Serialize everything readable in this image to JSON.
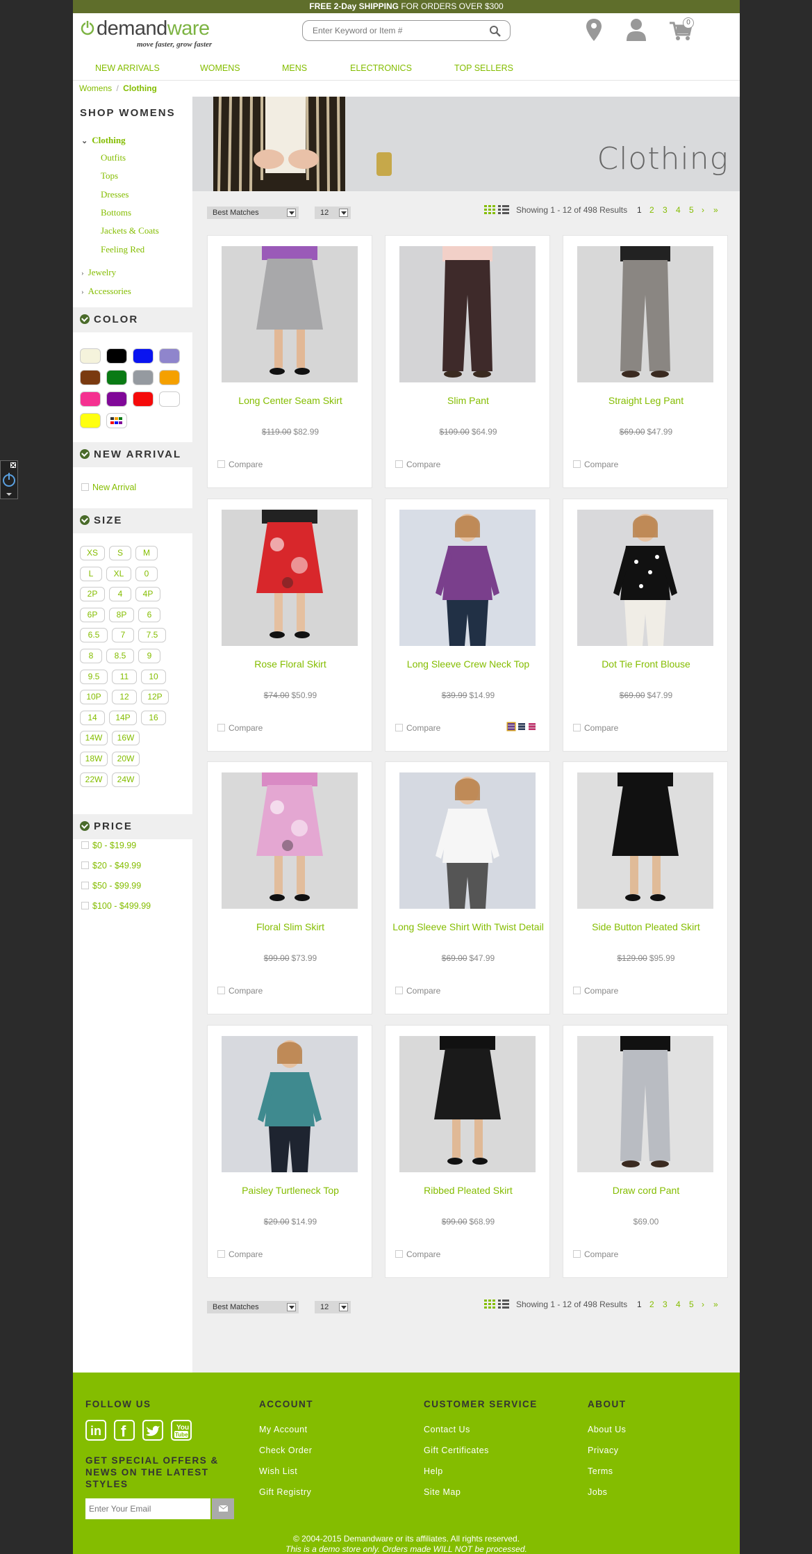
{
  "promo": {
    "bold": "FREE 2-Day SHIPPING",
    "rest": "FOR ORDERS OVER $300"
  },
  "logo": {
    "demand": "demand",
    "ware": "ware",
    "tagline": "move faster, grow faster"
  },
  "search": {
    "placeholder": "Enter Keyword or Item #"
  },
  "cart": {
    "count": "0"
  },
  "nav": [
    "NEW ARRIVALS",
    "WOMENS",
    "MENS",
    "ELECTRONICS",
    "TOP SELLERS"
  ],
  "breadcrumb": {
    "parent": "Womens",
    "separator": "/",
    "current": "Clothing"
  },
  "sidebar": {
    "shop_title": "SHOP WOMENS",
    "categories": {
      "active": "Clothing",
      "sub": [
        "Outfits",
        "Tops",
        "Dresses",
        "Bottoms",
        "Jackets & Coats",
        "Feeling Red"
      ],
      "others": [
        "Jewelry",
        "Accessories"
      ]
    },
    "color_title": "COLOR",
    "colors": [
      "#f5f3dc",
      "#000000",
      "#0a14f0",
      "#8f85cc",
      "#7a3a10",
      "#0a7a14",
      "#959aa0",
      "#f5a000",
      "#f53090",
      "#800898",
      "#f50a0a",
      "#ffffff",
      "#ffff10",
      "multicolor"
    ],
    "new_arrival_title": "NEW ARRIVAL",
    "new_arrival_option": "New Arrival",
    "size_title": "SIZE",
    "sizes": [
      "XS",
      "S",
      "M",
      "L",
      "XL",
      "0",
      "2P",
      "4",
      "4P",
      "6P",
      "8P",
      "6",
      "6.5",
      "7",
      "7.5",
      "8",
      "8.5",
      "9",
      "9.5",
      "11",
      "10",
      "10P",
      "12",
      "12P",
      "14",
      "14P",
      "16",
      "14W",
      "16W",
      "18W",
      "20W",
      "22W",
      "24W"
    ],
    "price_title": "PRICE",
    "prices": [
      "$0 - $19.99",
      "$20 - $49.99",
      "$50 - $99.99",
      "$100 - $499.99"
    ]
  },
  "banner": {
    "title": "Clothing"
  },
  "toolbar": {
    "sort": "Best Matches",
    "per_page": "12",
    "results": "Showing 1 - 12 of 498 Results",
    "pages": [
      "1",
      "2",
      "3",
      "4",
      "5"
    ],
    "next": "›",
    "last": "»"
  },
  "compare_label": "Compare",
  "products": [
    {
      "name": "Long Center Seam Skirt",
      "old": "$119.00",
      "price": "$82.99"
    },
    {
      "name": "Slim Pant",
      "old": "$109.00",
      "price": "$64.99"
    },
    {
      "name": "Straight Leg Pant",
      "old": "$69.00",
      "price": "$47.99"
    },
    {
      "name": "Rose Floral Skirt",
      "old": "$74.00",
      "price": "$50.99"
    },
    {
      "name": "Long Sleeve Crew Neck Top",
      "old": "$39.99",
      "price": "$14.99"
    },
    {
      "name": "Dot Tie Front Blouse",
      "old": "$69.00",
      "price": "$47.99"
    },
    {
      "name": "Floral Slim Skirt",
      "old": "$99.00",
      "price": "$73.99"
    },
    {
      "name": "Long Sleeve Shirt With Twist Detail",
      "old": "$69.00",
      "price": "$47.99"
    },
    {
      "name": "Side Button Pleated Skirt",
      "old": "$129.00",
      "price": "$95.99"
    },
    {
      "name": "Paisley Turtleneck Top",
      "old": "$29.00",
      "price": "$14.99"
    },
    {
      "name": "Ribbed Pleated Skirt",
      "old": "$99.00",
      "price": "$68.99"
    },
    {
      "name": "Draw cord Pant",
      "old": "",
      "price": "$69.00"
    }
  ],
  "footer": {
    "follow": "FOLLOW US",
    "social": [
      "in",
      "f",
      "twitter",
      "You Tube"
    ],
    "offers": "GET SPECIAL OFFERS & NEWS ON THE LATEST STYLES",
    "email_placeholder": "Enter Your Email",
    "account_title": "ACCOUNT",
    "account": [
      "My Account",
      "Check Order",
      "Wish List",
      "Gift Registry"
    ],
    "service_title": "CUSTOMER SERVICE",
    "service": [
      "Contact Us",
      "Gift Certificates",
      "Help",
      "Site Map"
    ],
    "about_title": "ABOUT",
    "about": [
      "About Us",
      "Privacy",
      "Terms",
      "Jobs"
    ],
    "copyright": "© 2004-2015 Demandware or its affiliates. All rights reserved.",
    "demo_note": "This is a demo store only. Orders made WILL NOT be processed."
  }
}
